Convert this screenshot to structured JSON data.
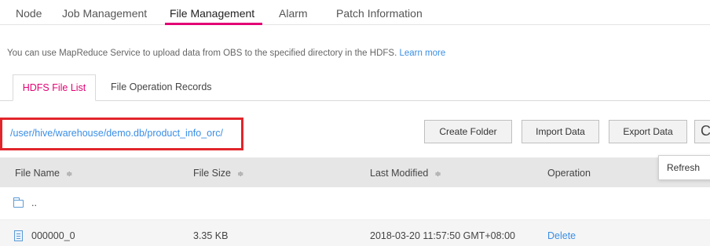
{
  "top_nav": {
    "tabs": [
      {
        "label": "Node"
      },
      {
        "label": "Job Management"
      },
      {
        "label": "File Management"
      },
      {
        "label": "Alarm"
      },
      {
        "label": "Patch Information"
      }
    ],
    "active_tab": "File Management",
    "accent_color": "#e20074"
  },
  "info": {
    "text": "You can use MapReduce Service to upload data from OBS to the specified directory in the HDFS.",
    "link": "Learn more"
  },
  "sub_tabs": {
    "tabs": [
      {
        "label": "HDFS File List"
      },
      {
        "label": "File Operation Records"
      }
    ],
    "active_tab": "HDFS File List"
  },
  "path": {
    "value": "/user/hive/warehouse/demo.db/product_info_orc/",
    "highlight_color": "#e1252b"
  },
  "toolbar": {
    "create_folder": "Create Folder",
    "import_data": "Import Data",
    "export_data": "Export Data",
    "refresh_icon": "refresh-icon",
    "refresh_glyph": "C",
    "refresh_tooltip": "Refresh"
  },
  "table": {
    "headers": [
      "File Name",
      "File Size",
      "Last Modified",
      "Operation"
    ],
    "sort_glyph": "≑",
    "rows": [
      {
        "icon": "folder-icon",
        "name": "..",
        "size": "",
        "modified": "",
        "operation": ""
      },
      {
        "icon": "file-icon",
        "name": "000000_0",
        "size": "3.35 KB",
        "modified": "2018-03-20 11:57:50 GMT+08:00",
        "operation": "Delete"
      }
    ]
  }
}
